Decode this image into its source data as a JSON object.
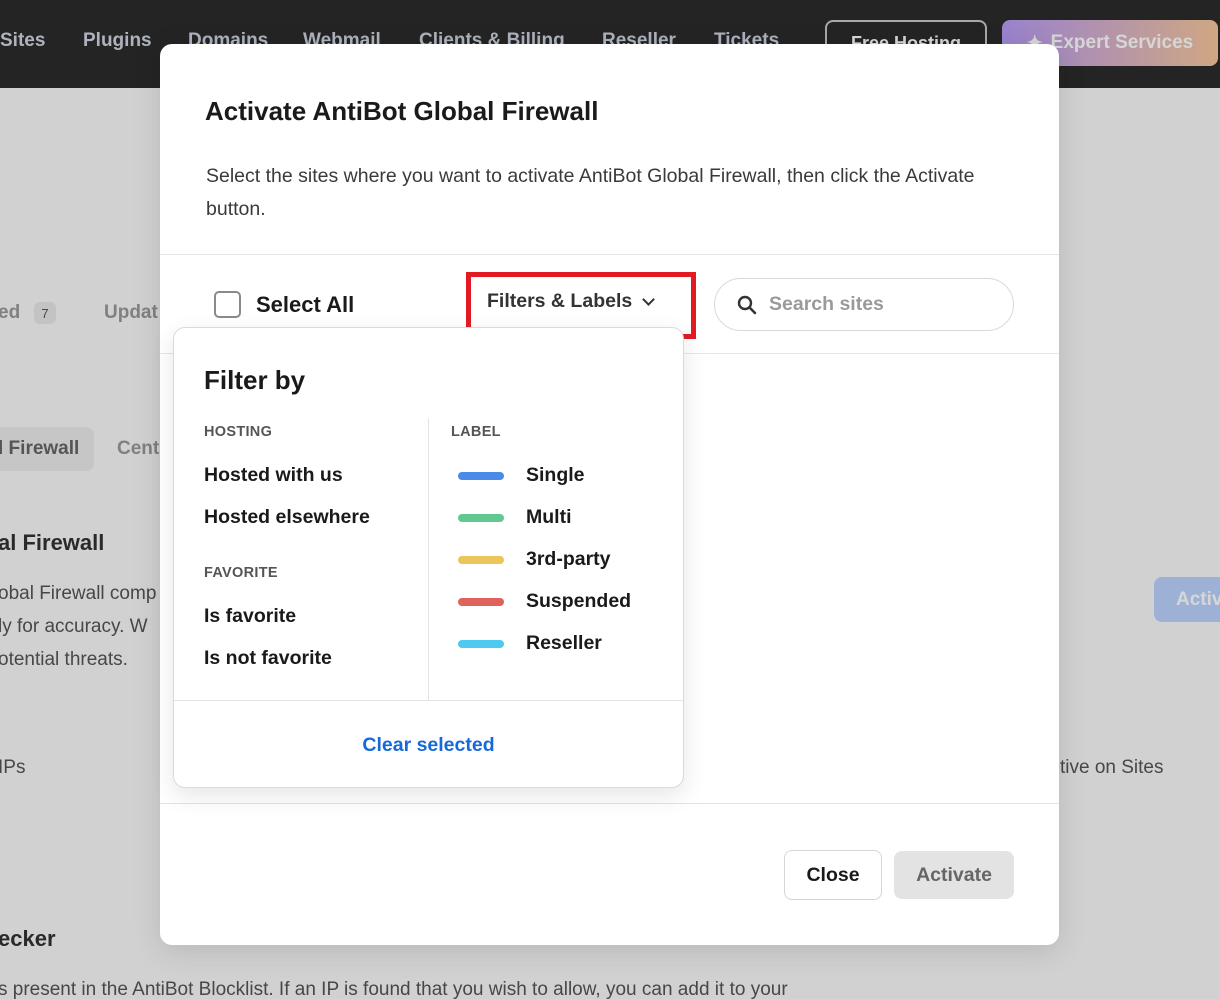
{
  "top_nav": {
    "items": [
      "Sites",
      "Plugins",
      "Domains",
      "Webmail",
      "Clients & Billing",
      "Reseller",
      "Tickets"
    ],
    "free_hosting": "Free Hosting",
    "expert_services": "Expert Services"
  },
  "background": {
    "filter_count": "7",
    "labels": [
      "ed",
      "Updat",
      "l Firewall",
      "Cent",
      "al Firewall",
      "obal Firewall comp",
      "ly for accuracy. W",
      "otential threats.",
      "IPs",
      "tive on Sites",
      "ecker",
      "s present in the AntiBot Blocklist. If an IP is found that you wish to allow, you can add it to your",
      "Activ"
    ]
  },
  "modal": {
    "title": "Activate AntiBot Global Firewall",
    "description": "Select the sites where you want to activate AntiBot Global Firewall, then click the Activate button.",
    "select_all_label": "Select All",
    "filters_button_label": "Filters & Labels",
    "search_placeholder": "Search sites",
    "close_label": "Close",
    "activate_label": "Activate"
  },
  "filter_dropdown": {
    "title": "Filter by",
    "hosting": {
      "label": "HOSTING",
      "options": [
        "Hosted with us",
        "Hosted elsewhere"
      ]
    },
    "favorite": {
      "label": "FAVORITE",
      "options": [
        "Is favorite",
        "Is not favorite"
      ]
    },
    "label_section": {
      "label": "LABEL",
      "options": [
        {
          "name": "Single",
          "color": "#4a8ae8"
        },
        {
          "name": "Multi",
          "color": "#5fc98f"
        },
        {
          "name": "3rd-party",
          "color": "#ecc65a"
        },
        {
          "name": "Suspended",
          "color": "#e0625a"
        },
        {
          "name": "Reseller",
          "color": "#4ec9ef"
        }
      ]
    },
    "clear_label": "Clear selected"
  },
  "colors": {
    "highlight": "#e21b23",
    "link": "#1769d8"
  }
}
